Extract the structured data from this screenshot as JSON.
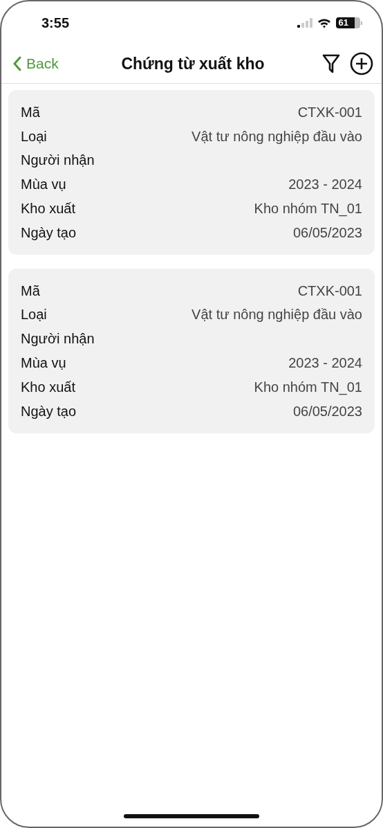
{
  "status_bar": {
    "time": "3:55",
    "battery": "61"
  },
  "nav": {
    "back": "Back",
    "title": "Chứng từ xuất kho"
  },
  "records": [
    {
      "fields": [
        {
          "label": "Mã",
          "value": "CTXK-001"
        },
        {
          "label": "Loại",
          "value": "Vật tư nông nghiệp đầu vào"
        },
        {
          "label": "Người nhận"
        },
        {
          "label": "Mùa vụ",
          "value": "2023 - 2024"
        },
        {
          "label": "Kho xuất",
          "value": "Kho nhóm TN_01"
        },
        {
          "label": "Ngày tạo",
          "value": "06/05/2023"
        }
      ]
    },
    {
      "fields": [
        {
          "label": "Mã",
          "value": "CTXK-001"
        },
        {
          "label": "Loại",
          "value": "Vật tư nông nghiệp đầu vào"
        },
        {
          "label": "Người nhận"
        },
        {
          "label": "Mùa vụ",
          "value": "2023 - 2024"
        },
        {
          "label": "Kho xuất",
          "value": "Kho nhóm TN_01"
        },
        {
          "label": "Ngày tạo",
          "value": "06/05/2023"
        }
      ]
    }
  ]
}
